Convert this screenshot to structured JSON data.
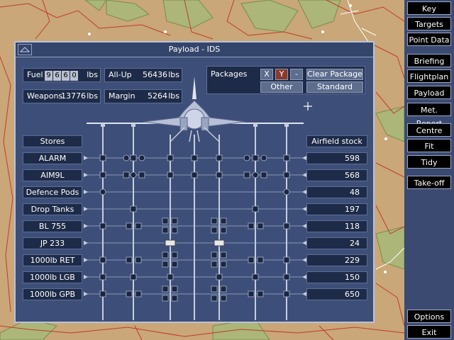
{
  "dialog": {
    "title": "Payload - IDS",
    "fuel": {
      "label": "Fuel",
      "digits": [
        "9",
        "6",
        "6",
        "0"
      ],
      "unit": "lbs"
    },
    "all_up": {
      "label": "All-Up",
      "value": "56436",
      "unit": "lbs"
    },
    "weapons": {
      "label": "Weapons",
      "value": "13776",
      "unit": "lbs"
    },
    "margin": {
      "label": "Margin",
      "value": "5264",
      "unit": "lbs"
    },
    "packages": {
      "label": "Packages",
      "x": "X",
      "y": "Y",
      "dash": "-",
      "clear": "Clear Package",
      "other": "Other",
      "standard": "Standard"
    },
    "stores_header": "Stores",
    "stock_header": "Airfield stock",
    "stores": [
      {
        "name": "ALARM",
        "stock": "598"
      },
      {
        "name": "AIM9L",
        "stock": "568"
      },
      {
        "name": "Defence Pods",
        "stock": "48"
      },
      {
        "name": "Drop Tanks",
        "stock": "197"
      },
      {
        "name": "BL 755",
        "stock": "118"
      },
      {
        "name": "JP 233",
        "stock": "24"
      },
      {
        "name": "1000lb RET",
        "stock": "229"
      },
      {
        "name": "1000lb LGB",
        "stock": "150"
      },
      {
        "name": "1000lb GPB",
        "stock": "650"
      }
    ]
  },
  "sidebar": {
    "items": [
      "Key",
      "Targets",
      "Point Data",
      "Briefing",
      "Flightplan",
      "Payload",
      "Met. Report",
      "Centre",
      "Fit",
      "Tidy",
      "Take-off",
      "Options",
      "Exit"
    ]
  },
  "colors": {
    "dialog_bg": "#3d4f78",
    "field_bg": "#1e2b48",
    "y_active": "#8a3a2a",
    "rail": "#c6cde0",
    "map": "#c9a778"
  }
}
